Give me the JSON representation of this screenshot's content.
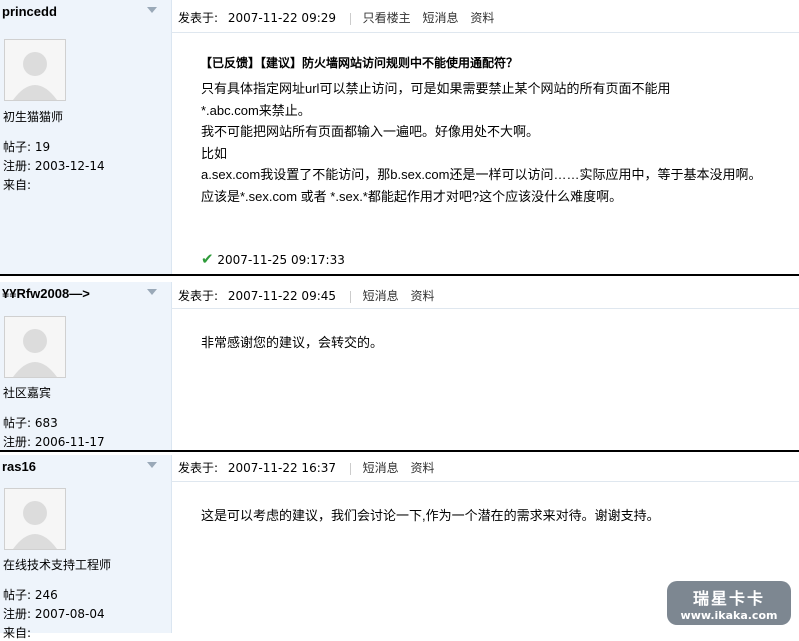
{
  "posts": [
    {
      "username": "princedd",
      "rank": "初生猫猫师",
      "posts_label": "帖子:",
      "posts": "19",
      "reg_label": "注册:",
      "reg_date": "2003-12-14",
      "from_label": "来自:",
      "posted_label": "发表于:",
      "datetime": "2007-11-22 09:29",
      "only_author": "只看楼主",
      "pm": "短消息",
      "profile": "资料",
      "title": "【已反馈】【建议】防火墙网站访问规则中不能使用通配符？",
      "lines": [
        "只有具体指定网址url可以禁止访问，可是如果需要禁止某个网站的所有页面不能用",
        "*.abc.com来禁止。",
        "我不可能把网站所有页面都输入一遍吧。好像用处不大啊。",
        "比如",
        "a.sex.com我设置了不能访问，那b.sex.com还是一样可以访问……实际应用中，等于基本没用啊。",
        "应该是*.sex.com 或者 *.sex.*都能起作用才对吧?这个应该没什么难度啊。"
      ],
      "check_time": "2007-11-25 09:17:33"
    },
    {
      "username": "¥¥Rfw2008—>",
      "rank": "社区嘉宾",
      "posts_label": "帖子:",
      "posts": "683",
      "reg_label": "注册:",
      "reg_date": "2006-11-17",
      "posted_label": "发表于:",
      "datetime": "2007-11-22 09:45",
      "pm": "短消息",
      "profile": "资料",
      "body": "非常感谢您的建议，会转交的。"
    },
    {
      "username": "ras16",
      "rank": "在线技术支持工程师",
      "posts_label": "帖子:",
      "posts": "246",
      "reg_label": "注册:",
      "reg_date": "2007-08-04",
      "from_label": "来自:",
      "posted_label": "发表于:",
      "datetime": "2007-11-22 16:37",
      "pm": "短消息",
      "profile": "资料",
      "body": "这是可以考虑的建议，我们会讨论一下,作为一个潜在的需求来对待。谢谢支持。"
    }
  ],
  "watermark": {
    "brand": "瑞星卡卡",
    "url": "www.ikaka.com"
  }
}
